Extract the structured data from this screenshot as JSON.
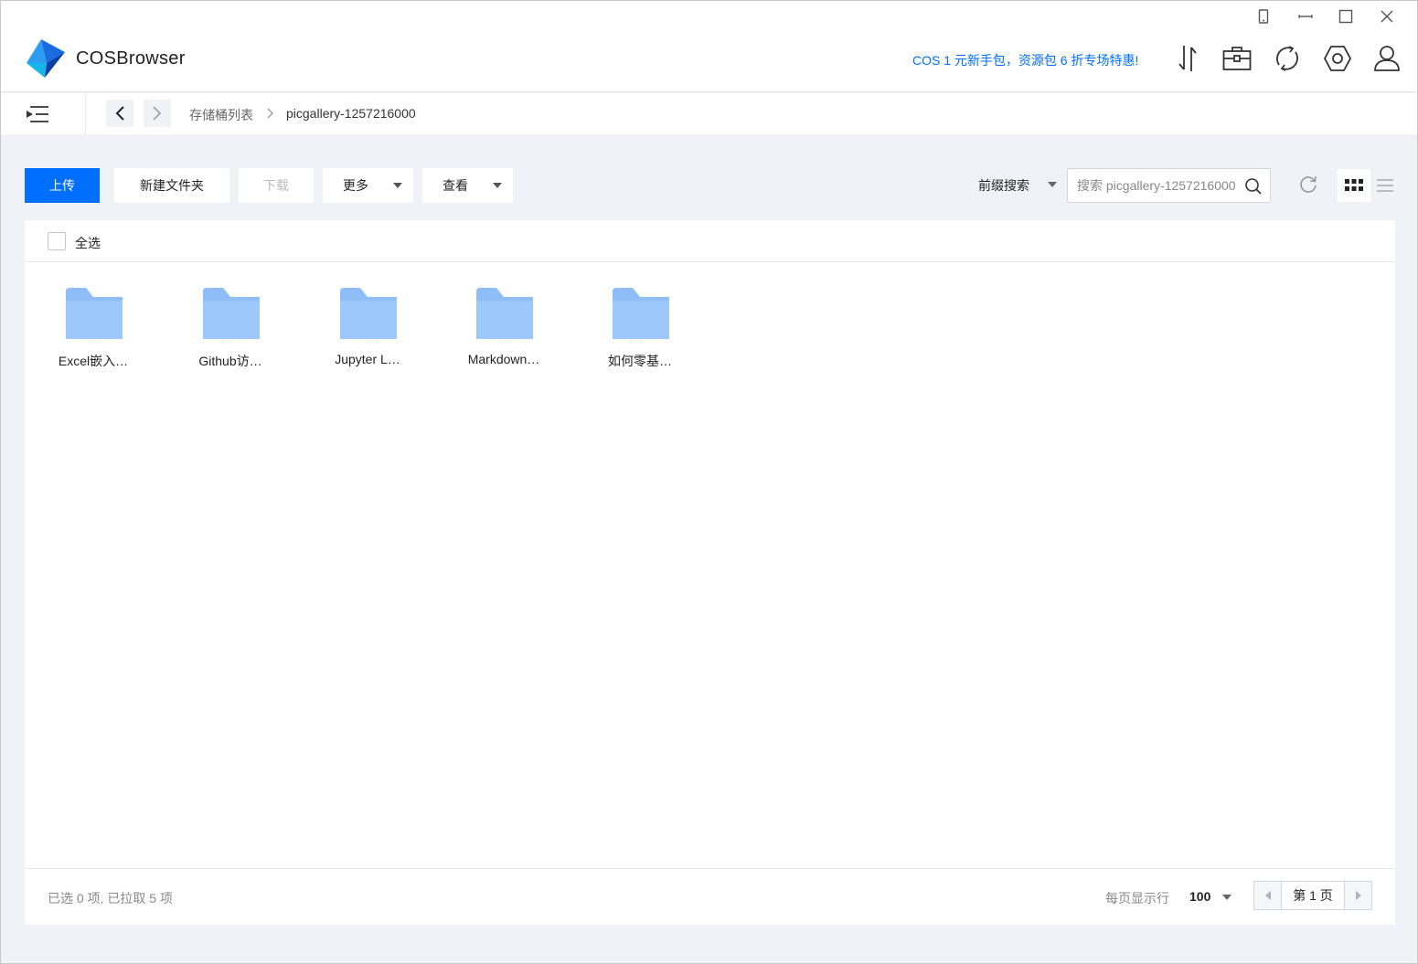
{
  "app": {
    "title": "COSBrowser",
    "logo_icon": "cosbrowser-logo",
    "window_controls": [
      "mobile-icon",
      "minimize-icon",
      "maximize-icon",
      "close-icon"
    ]
  },
  "header": {
    "promo": "COS 1 元新手包，资源包 6 折专场特惠!",
    "icons": [
      "transfer-icon",
      "toolbox-icon",
      "sync-icon",
      "settings-icon",
      "user-icon"
    ]
  },
  "breadcrumb": {
    "root": "存储桶列表",
    "current": "picgallery-1257216000"
  },
  "toolbar": {
    "upload": "上传",
    "new_folder": "新建文件夹",
    "download": "下载",
    "more": "更多",
    "view": "查看",
    "prefix_search": "前缀搜索",
    "search_placeholder": "搜索 picgallery-1257216000"
  },
  "list": {
    "select_all": "全选",
    "items": [
      {
        "name": "Excel嵌入…",
        "type": "folder-icon"
      },
      {
        "name": "Github访…",
        "type": "folder-icon"
      },
      {
        "name": "Jupyter L…",
        "type": "folder-icon"
      },
      {
        "name": "Markdown…",
        "type": "folder-icon"
      },
      {
        "name": "如何零基…",
        "type": "folder-icon"
      }
    ]
  },
  "footer": {
    "status": "已选 0 项, 已拉取 5 项",
    "rows_label": "每页显示行",
    "rows_value": "100",
    "page": "第 1 页"
  },
  "colors": {
    "accent": "#006eff",
    "folder": "#9cc8fb",
    "background": "#eff2f6"
  }
}
